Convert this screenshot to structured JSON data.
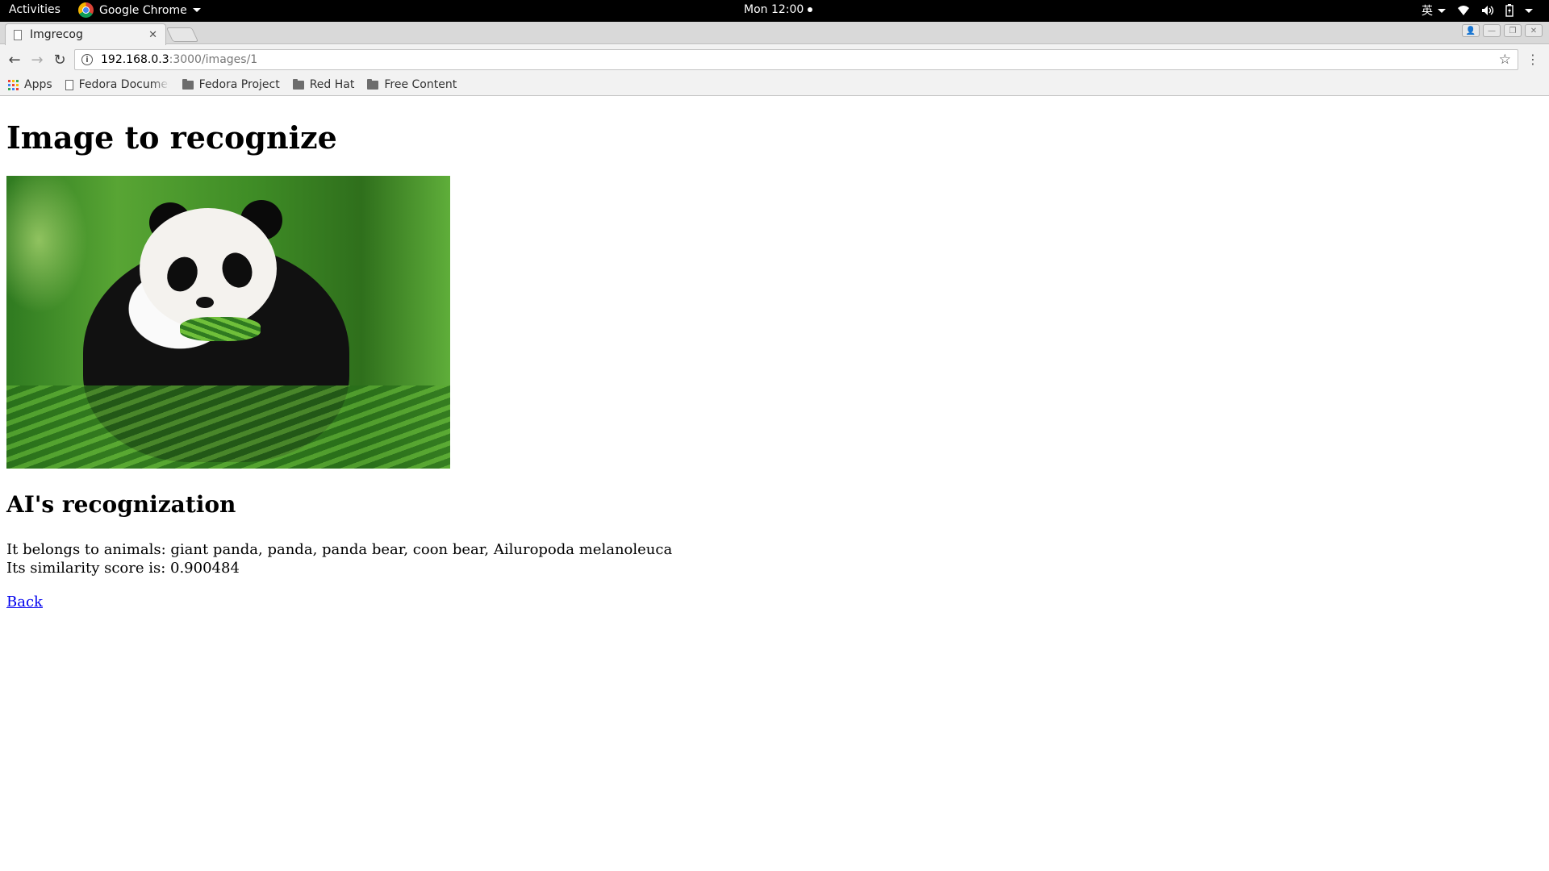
{
  "system_bar": {
    "activities": "Activities",
    "app_name": "Google Chrome",
    "clock": "Mon 12:00",
    "input_method": "英"
  },
  "browser": {
    "tab_title": "Imgrecog",
    "url_host": "192.168.0.3",
    "url_path": ":3000/images/1",
    "bookmarks": [
      {
        "label": "Apps",
        "icon": "apps-icon"
      },
      {
        "label": "Fedora Documen",
        "icon": "page-icon"
      },
      {
        "label": "Fedora Project",
        "icon": "folder-icon"
      },
      {
        "label": "Red Hat",
        "icon": "folder-icon"
      },
      {
        "label": "Free Content",
        "icon": "folder-icon"
      }
    ]
  },
  "page": {
    "heading": "Image to recognize",
    "image_subject": "giant panda eating bamboo",
    "subheading": "AI's recognization",
    "result_line1": "It belongs to animals: giant panda, panda, panda bear, coon bear, Ailuropoda melanoleuca",
    "result_line2": "Its similarity score is: 0.900484",
    "back_link": "Back"
  }
}
